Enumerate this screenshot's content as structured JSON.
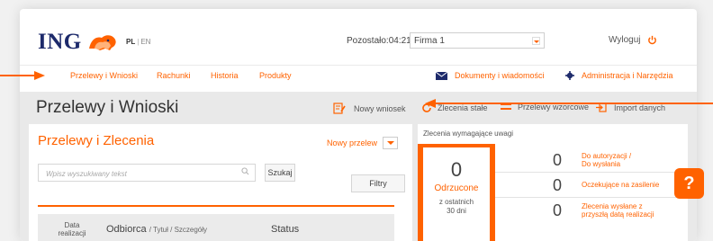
{
  "header": {
    "logo": "ING",
    "lang_active": "PL",
    "lang_sep": "|",
    "lang_inactive": "EN",
    "remaining": "Pozostało:04:21",
    "company": "Firma 1",
    "logout": "Wyloguj",
    "logout_icon": "power-icon"
  },
  "nav": {
    "items": [
      "Przelewy i Wnioski",
      "Rachunki",
      "Historia",
      "Produkty"
    ],
    "documents": "Dokumenty i wiadomości",
    "admin": "Administracja i Narzędzia"
  },
  "page": {
    "title": "Przelewy i Wnioski",
    "actions": {
      "new_request": "Nowy wniosek",
      "standing_orders": "Zlecenia stałe",
      "templates": "Przelewy wzorcowe",
      "import": "Import danych"
    }
  },
  "left_panel": {
    "title": "Przelewy i Zlecenia",
    "new_transfer": "Nowy przelew",
    "search_placeholder": "Wpisz wyszukiwany tekst",
    "search_button": "Szukaj",
    "filters_button": "Filtry",
    "columns": {
      "date_line1": "Data",
      "date_line2": "realizacji",
      "recipient": "Odbiorca",
      "recipient_sub": "/ Tytuł / Szczegóły",
      "status": "Status"
    }
  },
  "right_panel": {
    "title": "Zlecenia wymagające uwagi",
    "rejected": {
      "count": "0",
      "label": "Odrzucone",
      "sub1": "z ostatnich",
      "sub2": "30 dni"
    },
    "rows": [
      {
        "count": "0",
        "label1": "Do autoryzacji /",
        "label2": "Do wysłania"
      },
      {
        "count": "0",
        "label1": "Oczekujące na zasilenie",
        "label2": ""
      },
      {
        "count": "0",
        "label1": "Zlecenia wysłane z",
        "label2": "przyszłą datą realizacji"
      }
    ]
  },
  "help": "?",
  "colors": {
    "accent": "#ff6200",
    "brand": "#1d2a6b",
    "band": "#e9e9e9"
  }
}
